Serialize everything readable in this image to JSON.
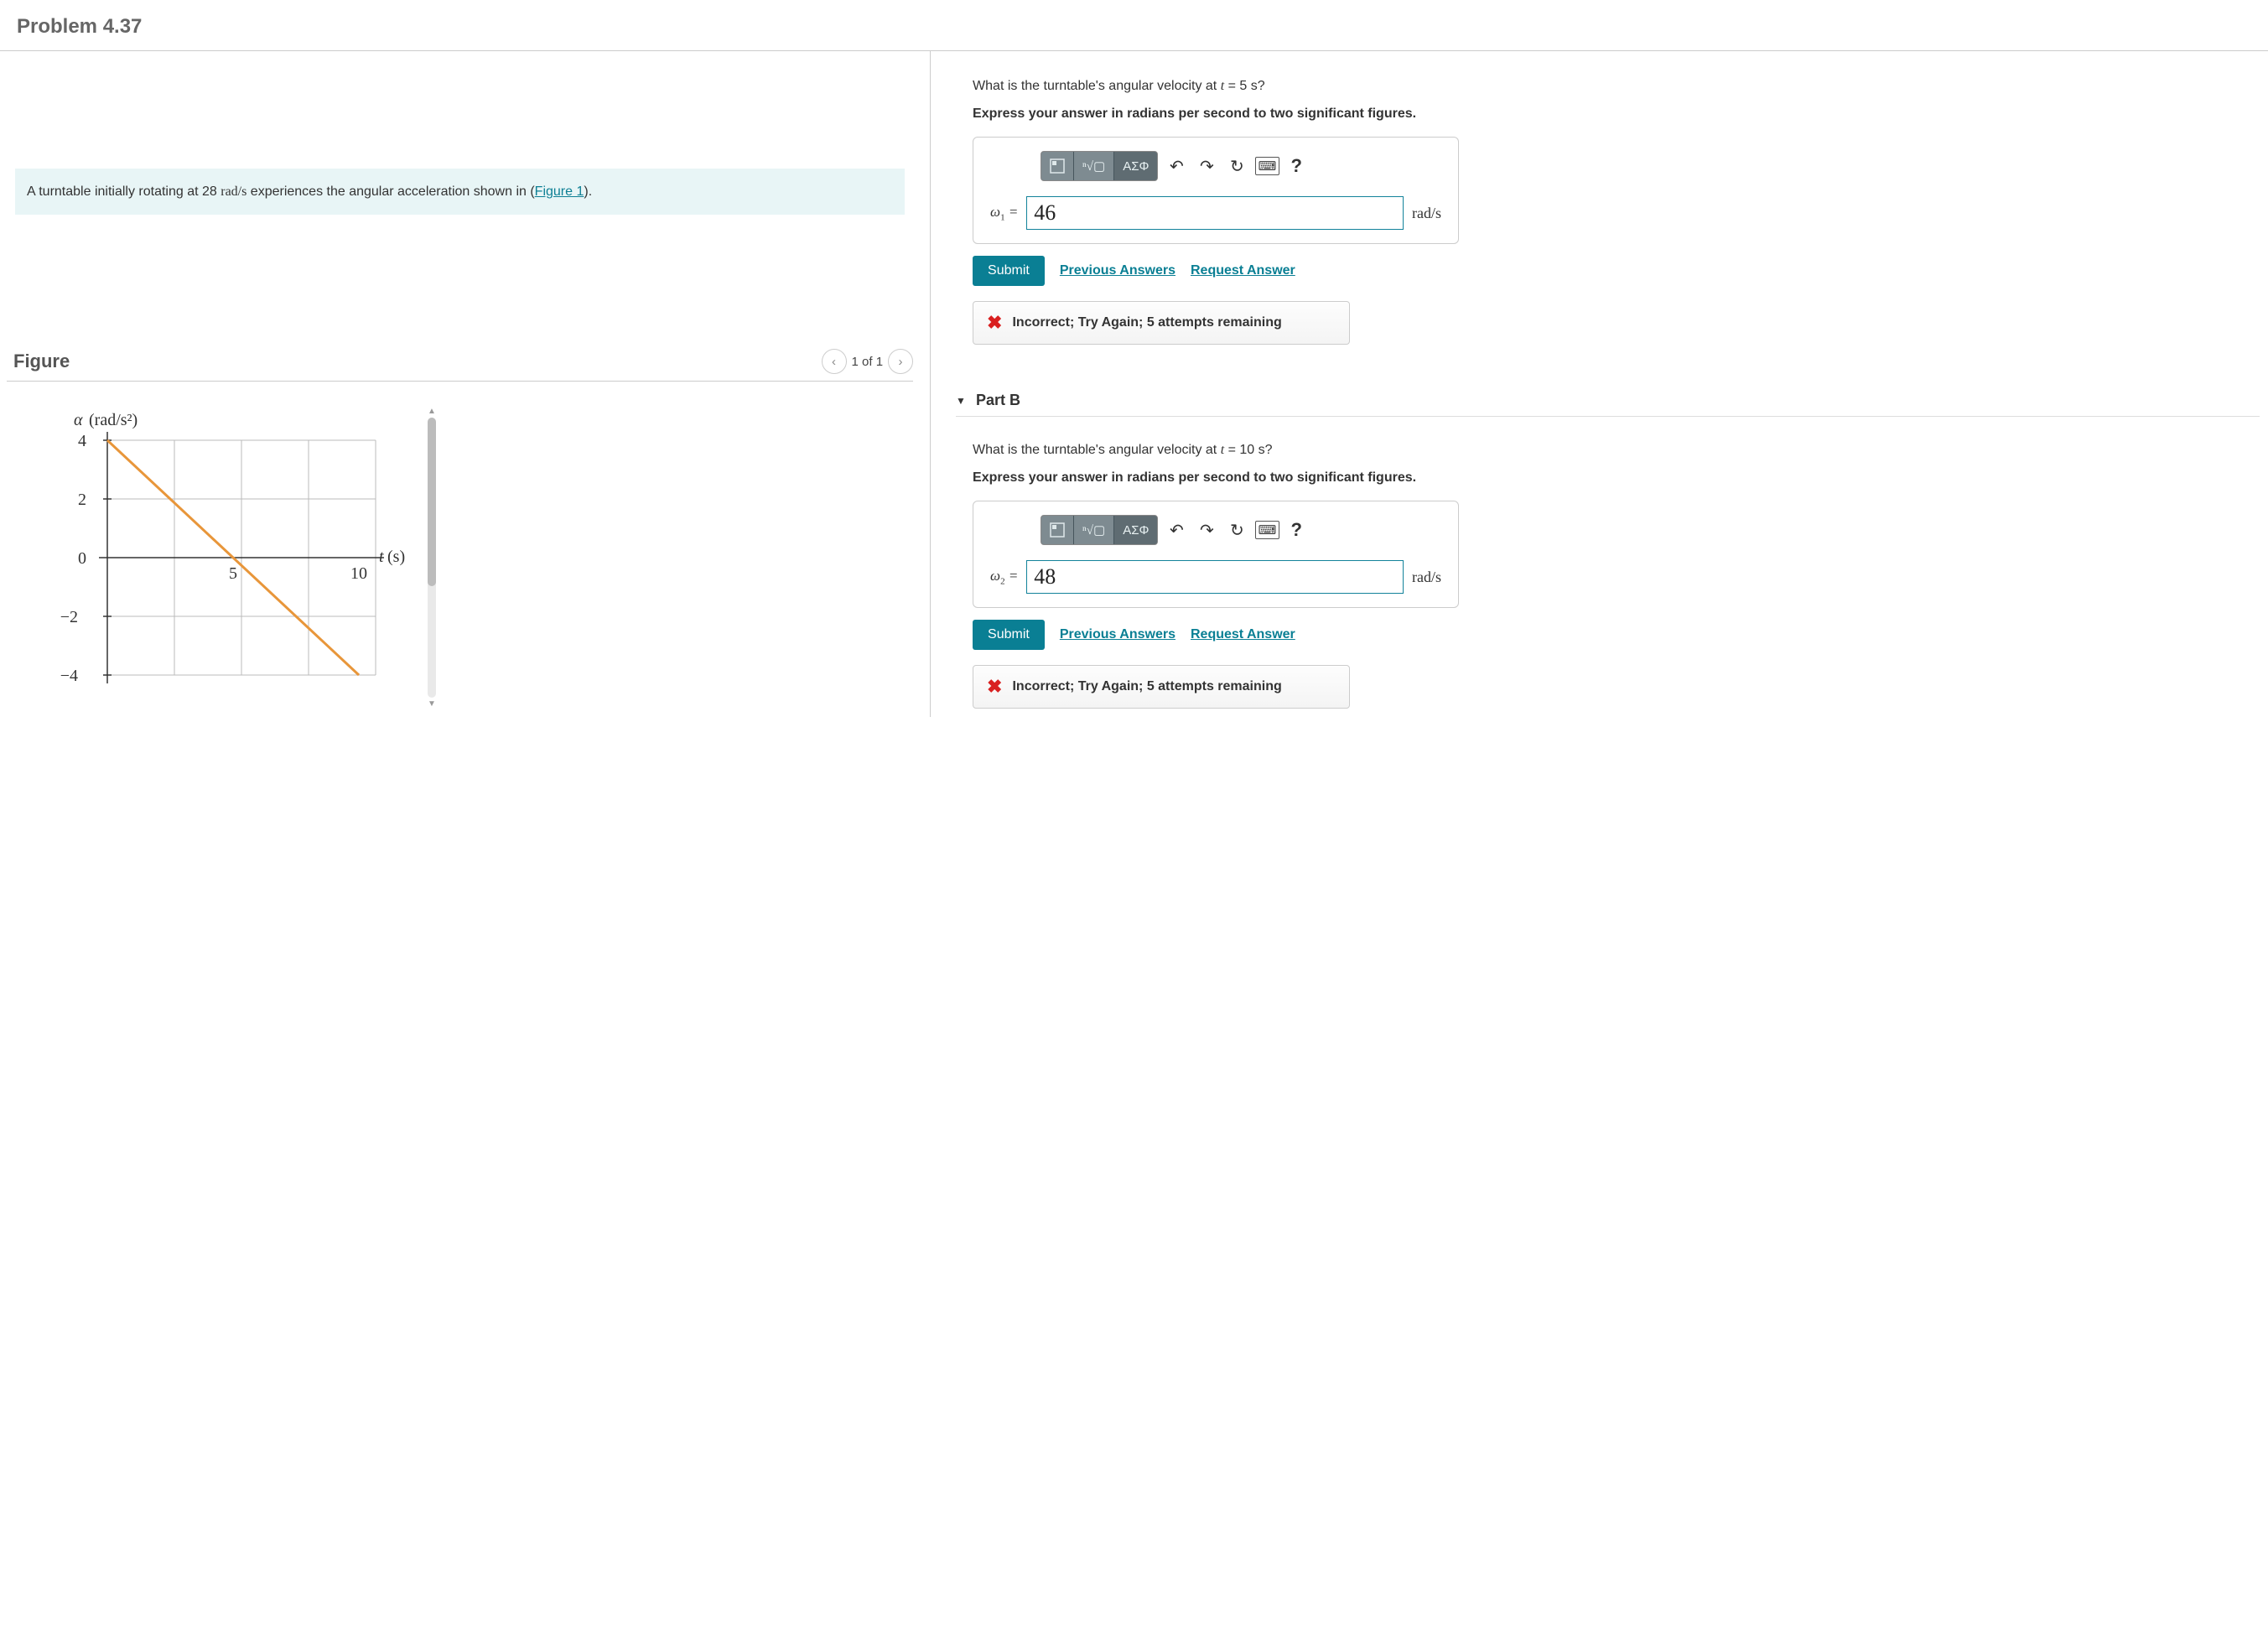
{
  "page_title": "Problem 4.37",
  "problem": {
    "intro_pre": "A turntable initially rotating at 28 ",
    "intro_units": "rad/s",
    "intro_post": " experiences the angular acceleration shown in (",
    "figure_link": "Figure 1",
    "intro_end": ")."
  },
  "figure": {
    "heading": "Figure",
    "pager": "1 of 1",
    "ylabel": "α (rad/s²)",
    "xlabel": "t (s)"
  },
  "chart_data": {
    "type": "line",
    "title": "",
    "xlabel": "t (s)",
    "ylabel": "α (rad/s²)",
    "xlim": [
      0,
      10
    ],
    "ylim": [
      -4,
      4
    ],
    "x_major_ticks": [
      5,
      10
    ],
    "y_major_ticks": [
      -4,
      -2,
      0,
      2,
      4
    ],
    "series": [
      {
        "name": "alpha",
        "x": [
          0,
          10
        ],
        "y": [
          4,
          -4
        ]
      }
    ]
  },
  "toolbar": {
    "greek_label": "ΑΣΦ"
  },
  "partA": {
    "question_pre": "What is the turntable's angular velocity at ",
    "question_var": "t",
    "question_post": " = 5 s?",
    "instruction": "Express your answer in radians per second to two significant figures.",
    "var_label": "ω",
    "var_sub": "1",
    "eq": " = ",
    "value": "46",
    "unit": "rad/s",
    "submit": "Submit",
    "prev": "Previous Answers",
    "req": "Request Answer",
    "feedback": "Incorrect; Try Again; 5 attempts remaining"
  },
  "partB": {
    "heading": "Part B",
    "question_pre": "What is the turntable's angular velocity at ",
    "question_var": "t",
    "question_post": " = 10 s?",
    "instruction": "Express your answer in radians per second to two significant figures.",
    "var_label": "ω",
    "var_sub": "2",
    "eq": " = ",
    "value": "48",
    "unit": "rad/s",
    "submit": "Submit",
    "prev": "Previous Answers",
    "req": "Request Answer",
    "feedback": "Incorrect; Try Again; 5 attempts remaining"
  }
}
